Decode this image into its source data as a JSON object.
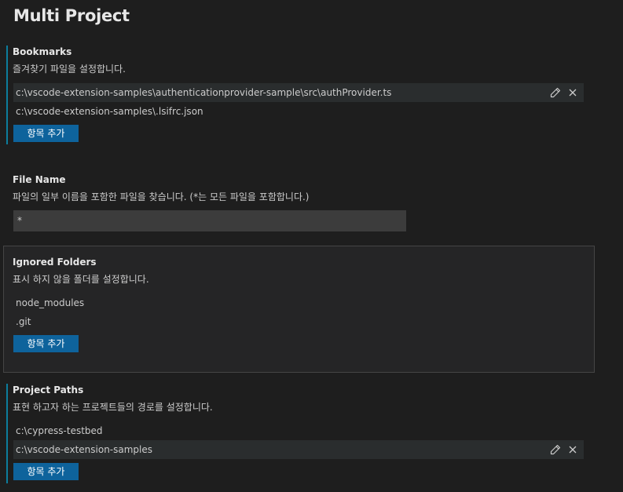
{
  "page": {
    "title": "Multi Project"
  },
  "bookmarks": {
    "title": "Bookmarks",
    "description": "즐겨찾기 파일을 설정합니다.",
    "items": [
      "c:\\vscode-extension-samples\\authenticationprovider-sample\\src\\authProvider.ts",
      "c:\\vscode-extension-samples\\.lsifrc.json"
    ],
    "add_label": "항목 추가"
  },
  "file_name": {
    "title": "File Name",
    "description": "파일의 일부 이름을 포함한 파일을 찾습니다. (*는 모든 파일을 포함합니다.)",
    "value": "*"
  },
  "ignored_folders": {
    "title": "Ignored Folders",
    "description": "표시 하지 않을 폴더를 설정합니다.",
    "items": [
      "node_modules",
      ".git"
    ],
    "add_label": "항목 추가"
  },
  "project_paths": {
    "title": "Project Paths",
    "description": "표현 하고자 하는 프로젝트들의 경로를 설정합니다.",
    "items": [
      "c:\\cypress-testbed",
      "c:\\vscode-extension-samples"
    ],
    "add_label": "항목 추가"
  },
  "icons": {
    "edit": "pencil-icon",
    "remove": "close-icon"
  },
  "colors": {
    "background": "#1e1e1e",
    "modified_indicator": "#0c7d9d",
    "button": "#0e639c",
    "input_background": "#3c3c3c",
    "hover_row": "#2a2d2e"
  }
}
